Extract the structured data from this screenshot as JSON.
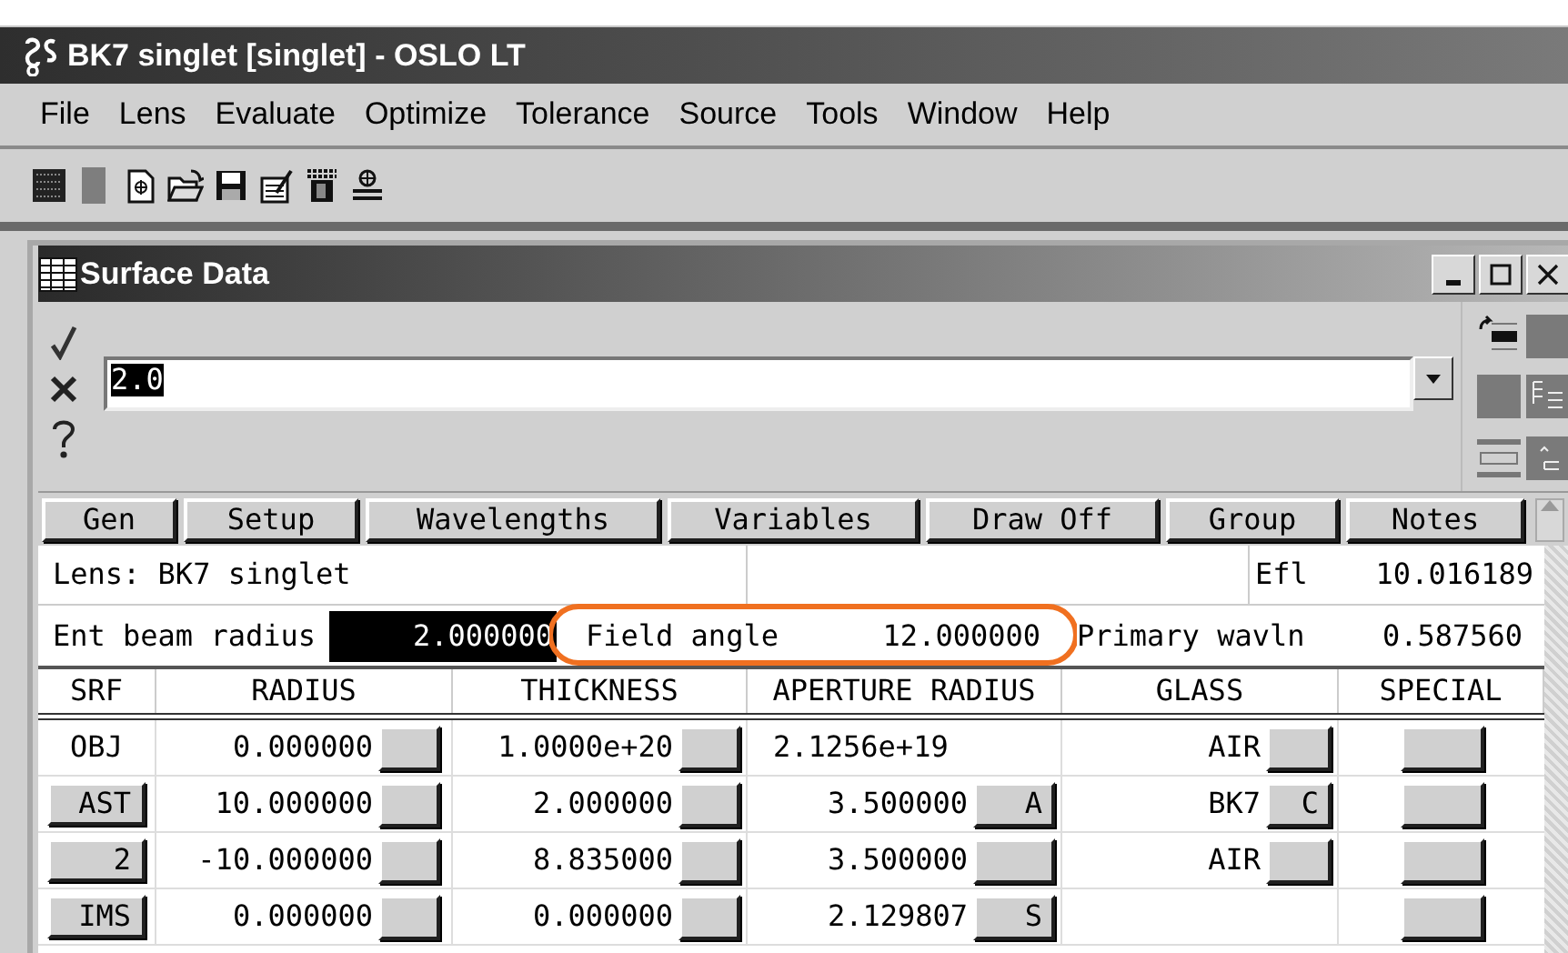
{
  "app": {
    "title": "BK7 singlet [singlet] - OSLO LT"
  },
  "menu": [
    "File",
    "Lens",
    "Evaluate",
    "Optimize",
    "Tolerance",
    "Source",
    "Tools",
    "Window",
    "Help"
  ],
  "surface_window": {
    "title": "Surface Data",
    "command": {
      "value": "2.0",
      "selected": true
    },
    "buttons": [
      "Gen",
      "Setup",
      "Wavelengths",
      "Variables",
      "Draw Off",
      "Group",
      "Notes"
    ],
    "lens_row": {
      "label": "Lens: BK7 singlet",
      "efl_label": "Efl",
      "efl_value": "10.016189"
    },
    "params": [
      {
        "label": "Ent beam radius",
        "value": "2.000000",
        "selected": true
      },
      {
        "label": "Field angle",
        "value": "12.000000",
        "selected": false
      },
      {
        "label": "Primary wavln",
        "value": "0.587560",
        "selected": false
      }
    ],
    "table": {
      "columns": [
        "SRF",
        "RADIUS",
        "THICKNESS",
        "APERTURE RADIUS",
        "GLASS",
        "SPECIAL"
      ],
      "rows": [
        {
          "srf": "OBJ",
          "kind": "text",
          "radius": "0.000000",
          "thickness": "1.0000e+20",
          "aperture": "2.1256e+19",
          "aperture_button": false,
          "glass": "AIR",
          "glass_button": true
        },
        {
          "srf": "AST",
          "kind": "button",
          "radius": "10.000000",
          "thickness": "2.000000",
          "aperture": "3.500000",
          "aperture_button": true,
          "aperture_flag": "A",
          "glass": "BK7",
          "glass_button": true,
          "glass_flag": "C"
        },
        {
          "srf": "2",
          "kind": "button",
          "radius": "-10.000000",
          "thickness": "8.835000",
          "aperture": "3.500000",
          "aperture_button": true,
          "glass": "AIR",
          "glass_button": true
        },
        {
          "srf": "IMS",
          "kind": "button",
          "radius": "0.000000",
          "thickness": "0.000000",
          "aperture": "2.129807",
          "aperture_button": true,
          "aperture_flag": "S"
        }
      ]
    }
  }
}
